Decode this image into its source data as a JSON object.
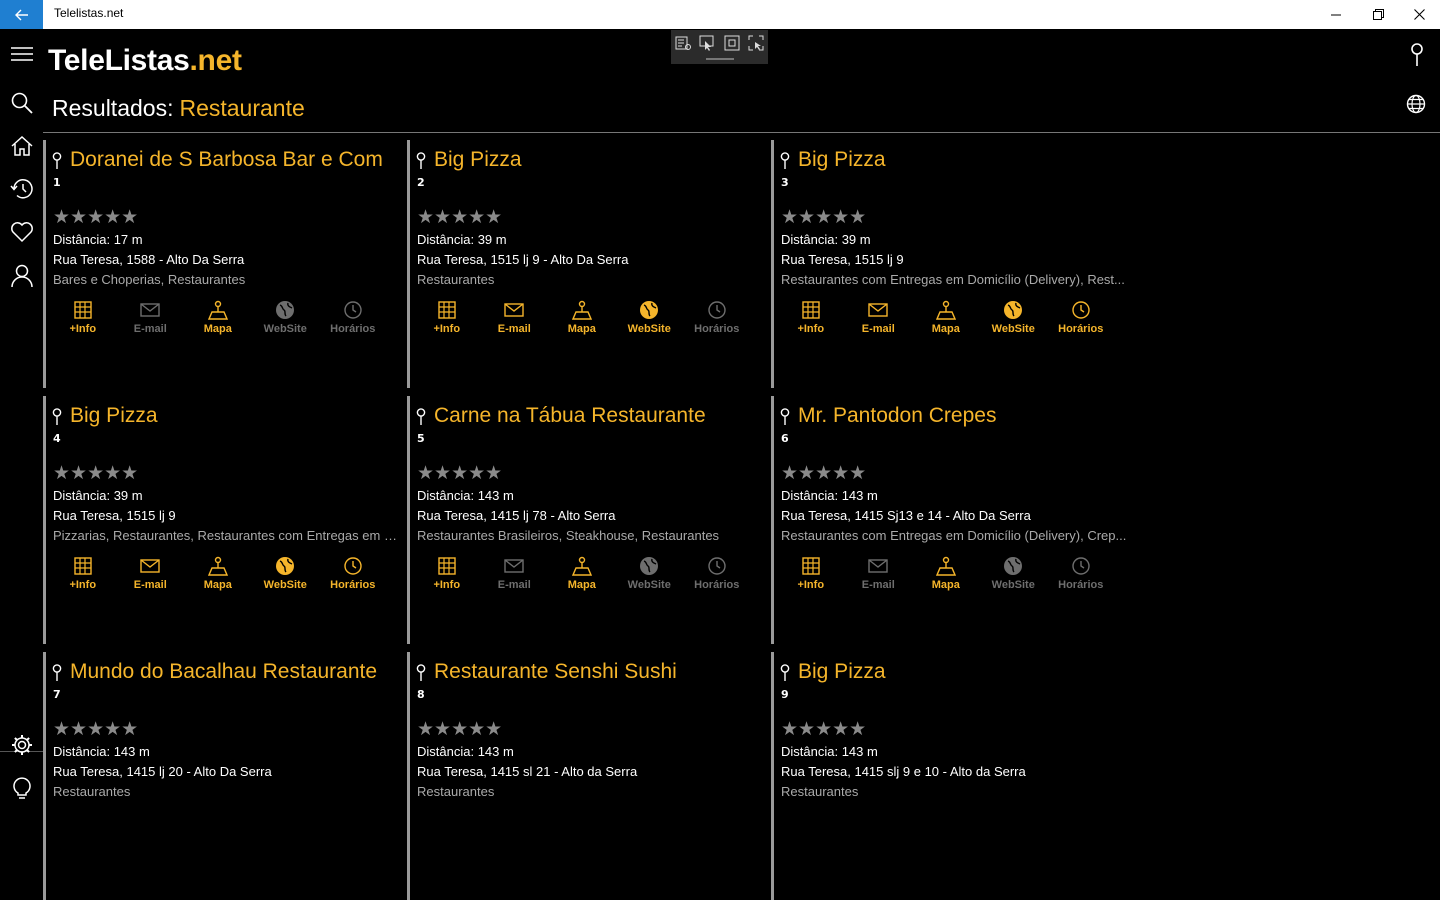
{
  "window": {
    "title": "Telelistas.net"
  },
  "app": {
    "logo_main": "TeleListas",
    "logo_suffix": ".net",
    "heading_label": "Resultados:",
    "query": "Restaurante"
  },
  "colors": {
    "accent": "#f5b52b",
    "titlebar_back": "#1f7fd1",
    "disabled": "#6e6e6e"
  },
  "rail": {
    "icons": [
      "hamburger-menu-icon",
      "search-icon",
      "home-icon",
      "history-icon",
      "heart-icon",
      "user-icon",
      "gear-icon",
      "lightbulb-icon"
    ]
  },
  "results": [
    {
      "num": "1",
      "name": "Doranei de S Barbosa Bar e Com",
      "stars": "★★★★★",
      "distance": "Distância: 17 m",
      "address": "Rua Teresa, 1588 - Alto Da Serra",
      "categories": "Bares e Choperias, Restaurantes",
      "actions": [
        {
          "label": "+Info",
          "enabled": true
        },
        {
          "label": "E-mail",
          "enabled": false
        },
        {
          "label": "Mapa",
          "enabled": true
        },
        {
          "label": "WebSite",
          "enabled": false
        },
        {
          "label": "Horários",
          "enabled": false
        }
      ]
    },
    {
      "num": "2",
      "name": "Big Pizza",
      "stars": "★★★★★",
      "distance": "Distância: 39 m",
      "address": "Rua Teresa, 1515 lj 9 - Alto Da Serra",
      "categories": "Restaurantes",
      "actions": [
        {
          "label": "+Info",
          "enabled": true
        },
        {
          "label": "E-mail",
          "enabled": true
        },
        {
          "label": "Mapa",
          "enabled": true
        },
        {
          "label": "WebSite",
          "enabled": true
        },
        {
          "label": "Horários",
          "enabled": false
        }
      ]
    },
    {
      "num": "3",
      "name": "Big Pizza",
      "stars": "★★★★★",
      "distance": "Distância: 39 m",
      "address": "Rua Teresa, 1515 lj 9",
      "categories": "Restaurantes com Entregas em Domicílio (Delivery), Rest...",
      "actions": [
        {
          "label": "+Info",
          "enabled": true
        },
        {
          "label": "E-mail",
          "enabled": true
        },
        {
          "label": "Mapa",
          "enabled": true
        },
        {
          "label": "WebSite",
          "enabled": true
        },
        {
          "label": "Horários",
          "enabled": true
        }
      ]
    },
    {
      "num": "4",
      "name": "Big Pizza",
      "stars": "★★★★★",
      "distance": "Distância: 39 m",
      "address": "Rua Teresa, 1515 lj 9",
      "categories": "Pizzarias, Restaurantes, Restaurantes com Entregas em D...",
      "actions": [
        {
          "label": "+Info",
          "enabled": true
        },
        {
          "label": "E-mail",
          "enabled": true
        },
        {
          "label": "Mapa",
          "enabled": true
        },
        {
          "label": "WebSite",
          "enabled": true
        },
        {
          "label": "Horários",
          "enabled": true
        }
      ]
    },
    {
      "num": "5",
      "name": "Carne na Tábua Restaurante",
      "stars": "★★★★★",
      "distance": "Distância: 143 m",
      "address": "Rua Teresa, 1415 lj 78 - Alto Serra",
      "categories": "Restaurantes Brasileiros, Steakhouse, Restaurantes",
      "actions": [
        {
          "label": "+Info",
          "enabled": true
        },
        {
          "label": "E-mail",
          "enabled": false
        },
        {
          "label": "Mapa",
          "enabled": true
        },
        {
          "label": "WebSite",
          "enabled": false
        },
        {
          "label": "Horários",
          "enabled": false
        }
      ]
    },
    {
      "num": "6",
      "name": "Mr. Pantodon Crepes",
      "stars": "★★★★★",
      "distance": "Distância: 143 m",
      "address": "Rua Teresa, 1415 Sj13 e 14 - Alto Da Serra",
      "categories": "Restaurantes com Entregas em Domicílio (Delivery), Crep...",
      "actions": [
        {
          "label": "+Info",
          "enabled": true
        },
        {
          "label": "E-mail",
          "enabled": false
        },
        {
          "label": "Mapa",
          "enabled": true
        },
        {
          "label": "WebSite",
          "enabled": false
        },
        {
          "label": "Horários",
          "enabled": false
        }
      ]
    },
    {
      "num": "7",
      "name": "Mundo do Bacalhau Restaurante",
      "stars": "★★★★★",
      "distance": "Distância: 143 m",
      "address": "Rua Teresa, 1415 lj 20 - Alto Da Serra",
      "categories": "Restaurantes",
      "actions": []
    },
    {
      "num": "8",
      "name": "Restaurante Senshi Sushi",
      "stars": "★★★★★",
      "distance": "Distância: 143 m",
      "address": "Rua Teresa, 1415 sl 21 - Alto da Serra",
      "categories": "Restaurantes",
      "actions": []
    },
    {
      "num": "9",
      "name": "Big Pizza",
      "stars": "★★★★★",
      "distance": "Distância: 143 m",
      "address": "Rua Teresa, 1415 slj 9 e 10 - Alto da Serra",
      "categories": "Restaurantes",
      "actions": []
    }
  ]
}
